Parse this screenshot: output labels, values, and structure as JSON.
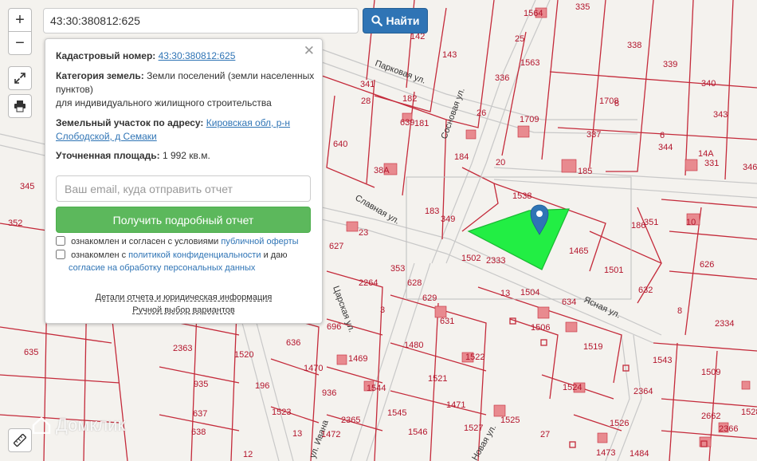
{
  "search": {
    "value": "43:30:380812:625",
    "button_label": "Найти"
  },
  "controls": {
    "zoom_in": "+",
    "zoom_out": "−"
  },
  "panel": {
    "cadastral_label": "Кадастровый номер:",
    "cadastral_value": "43:30:380812:625",
    "category_label": "Категория земель:",
    "category_value": "Земли поселений (земли населенных пунктов)",
    "category_use": "для индивидуального жилищного строительства",
    "address_label": "Земельный участок по адресу:",
    "address_value": "Кировская обл, р-н Слободской, д Семаки",
    "area_label": "Уточненная площадь:",
    "area_value": "1 992 кв.м.",
    "email_placeholder": "Ваш email, куда отправить отчет",
    "report_button": "Получить подробный отчет",
    "consent1_text": "ознакомлен и согласен с условиями",
    "consent1_link": "публичной оферты",
    "consent2_text": "ознакомлен с",
    "consent2_link1": "политикой конфиденциальности",
    "consent2_mid": "и даю",
    "consent2_link2": "согласие на обработку персональных данных",
    "details_link": "Детали отчета и юридическая информация",
    "manual_link": "Ручной выбор вариантов"
  },
  "map": {
    "streets": [
      "Парковая ул.",
      "Сосновая ул.",
      "Славная ул.",
      "Царская ул.",
      "Ясная ул.",
      "ул. Ивана",
      "Новая ул."
    ],
    "plots": [
      "1564",
      "335",
      "338",
      "339",
      "340",
      "142",
      "143",
      "25",
      "1563",
      "336",
      "1708",
      "8",
      "343",
      "341",
      "28",
      "182",
      "26",
      "1709",
      "337",
      "6",
      "344",
      "14А",
      "346",
      "640",
      "639",
      "181",
      "184",
      "20",
      "185",
      "331",
      "345",
      "38А",
      "1538",
      "183",
      "349",
      "186",
      "10",
      "351",
      "352",
      "23",
      "1465",
      "1501",
      "626",
      "627",
      "353",
      "1502",
      "2333",
      "632",
      "8",
      "628",
      "629",
      "2264",
      "13",
      "1504",
      "634",
      "3",
      "631",
      "1506",
      "2334",
      "635",
      "696",
      "1480",
      "1519",
      "2363",
      "636",
      "1469",
      "1520",
      "1522",
      "1543",
      "1509",
      "935",
      "196",
      "1470",
      "1544",
      "1521",
      "1524",
      "2364",
      "637",
      "936",
      "1471",
      "1523",
      "2365",
      "1545",
      "1525",
      "1526",
      "2662",
      "638",
      "13",
      "1472",
      "1546",
      "1527",
      "1528",
      "2366",
      "12",
      "27",
      "1473",
      "1484",
      "638",
      "3"
    ],
    "watermark": "Домклик"
  }
}
